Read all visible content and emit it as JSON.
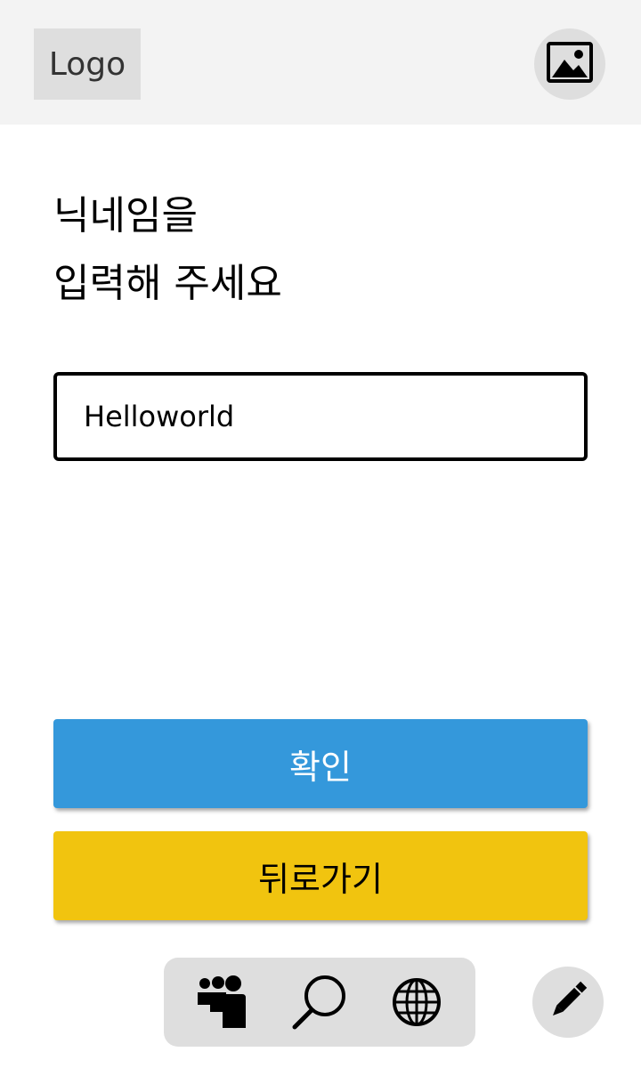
{
  "header": {
    "logo_text": "Logo",
    "profile_icon": "image-icon"
  },
  "main": {
    "title_line1": "닉네임을",
    "title_line2": "입력해 주세요",
    "nickname_value": "Helloworld"
  },
  "buttons": {
    "confirm_label": "확인",
    "back_label": "뒤로가기",
    "confirm_color": "#3498db",
    "back_color": "#f1c40f"
  },
  "bottom_nav": {
    "items": [
      {
        "icon": "people-icon"
      },
      {
        "icon": "search-icon"
      },
      {
        "icon": "globe-icon"
      }
    ]
  },
  "fab": {
    "icon": "pencil-icon"
  }
}
